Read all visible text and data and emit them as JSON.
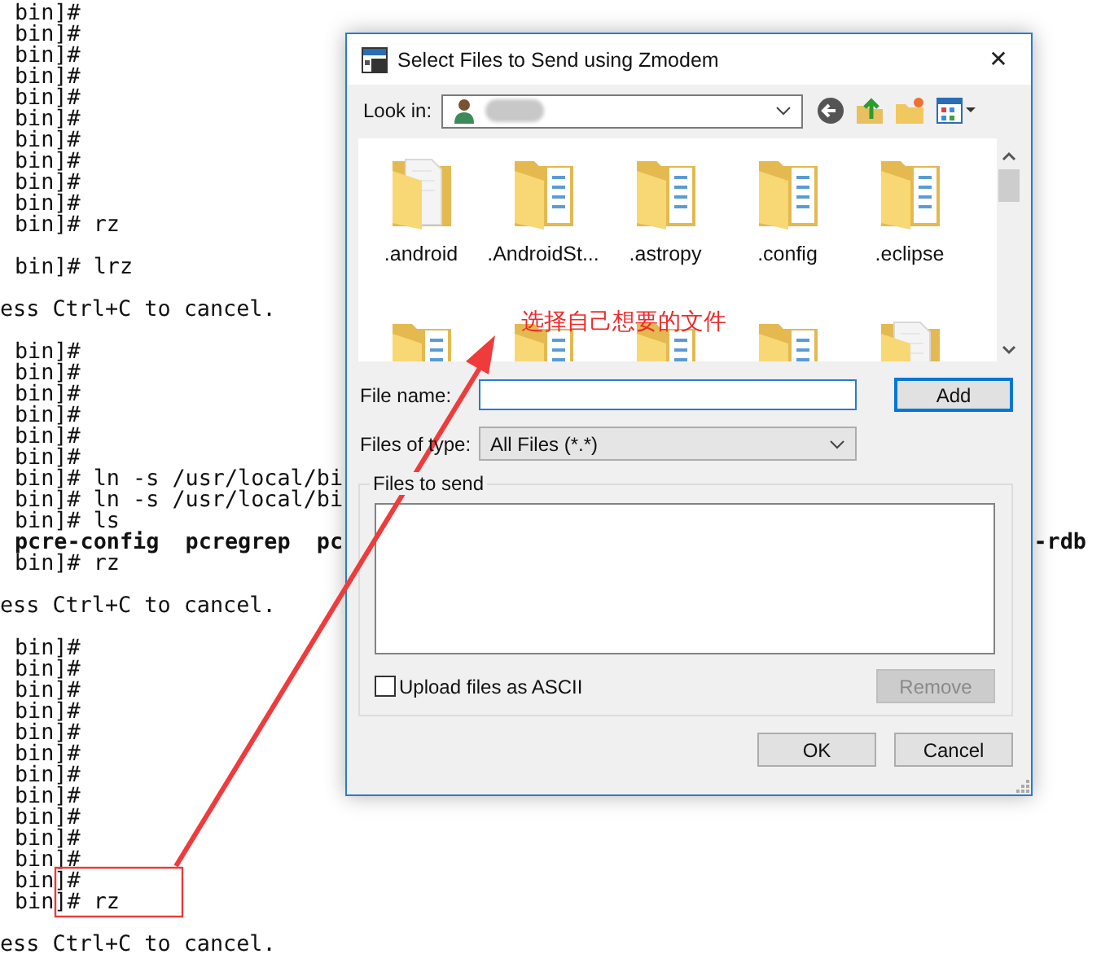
{
  "terminal": {
    "blocks": [
      [
        {
          "kind": "prompt",
          "text": "bin]#"
        },
        {
          "kind": "prompt",
          "text": "bin]#"
        },
        {
          "kind": "prompt",
          "text": "bin]#"
        },
        {
          "kind": "prompt",
          "text": "bin]#"
        },
        {
          "kind": "prompt",
          "text": "bin]#"
        },
        {
          "kind": "prompt",
          "text": "bin]#"
        },
        {
          "kind": "prompt",
          "text": "bin]#"
        },
        {
          "kind": "prompt",
          "text": "bin]#"
        },
        {
          "kind": "prompt",
          "text": "bin]#"
        },
        {
          "kind": "prompt",
          "text": "bin]#"
        },
        {
          "kind": "prompt",
          "text": "bin]# rz"
        }
      ],
      [
        {
          "kind": "prompt",
          "text": "bin]# lrz"
        }
      ],
      [
        {
          "kind": "message",
          "text": "ess Ctrl+C to cancel."
        }
      ],
      [
        {
          "kind": "prompt",
          "text": "bin]#"
        },
        {
          "kind": "prompt",
          "text": "bin]#"
        },
        {
          "kind": "prompt",
          "text": "bin]#"
        },
        {
          "kind": "prompt",
          "text": "bin]#"
        },
        {
          "kind": "prompt",
          "text": "bin]#"
        },
        {
          "kind": "prompt",
          "text": "bin]#"
        },
        {
          "kind": "prompt",
          "text": "bin]# ln -s /usr/local/bi"
        },
        {
          "kind": "prompt",
          "text": "bin]# ln -s /usr/local/bi"
        },
        {
          "kind": "prompt",
          "text": "bin]# ls"
        },
        {
          "kind": "listing",
          "text": "pcre-config  pcregrep  pc",
          "text_right": "-rdb"
        },
        {
          "kind": "prompt",
          "text": "bin]# rz"
        }
      ],
      [
        {
          "kind": "message",
          "text": "ess Ctrl+C to cancel."
        }
      ],
      [
        {
          "kind": "prompt",
          "text": "bin]#"
        },
        {
          "kind": "prompt",
          "text": "bin]#"
        },
        {
          "kind": "prompt",
          "text": "bin]#"
        },
        {
          "kind": "prompt",
          "text": "bin]#"
        },
        {
          "kind": "prompt",
          "text": "bin]#"
        },
        {
          "kind": "prompt",
          "text": "bin]#"
        },
        {
          "kind": "prompt",
          "text": "bin]#"
        },
        {
          "kind": "prompt",
          "text": "bin]#"
        },
        {
          "kind": "prompt",
          "text": "bin]#"
        },
        {
          "kind": "prompt",
          "text": "bin]#"
        },
        {
          "kind": "prompt",
          "text": "bin]#"
        },
        {
          "kind": "prompt",
          "text": "bin]#"
        },
        {
          "kind": "prompt",
          "text": "bin]# rz"
        }
      ],
      [
        {
          "kind": "message",
          "text": "ess Ctrl+C to cancel."
        }
      ]
    ]
  },
  "dialog": {
    "title": "Select Files to Send using Zmodem",
    "close": "✕",
    "look_in": {
      "label": "Look in:"
    },
    "files": [
      {
        "kind": "papers",
        "label": ".android"
      },
      {
        "kind": "plain",
        "label": ".AndroidSt..."
      },
      {
        "kind": "plain",
        "label": ".astropy"
      },
      {
        "kind": "plain",
        "label": ".config"
      },
      {
        "kind": "plain",
        "label": ".eclipse"
      },
      {
        "kind": "plain"
      },
      {
        "kind": "plain"
      },
      {
        "kind": "plain"
      },
      {
        "kind": "plain"
      },
      {
        "kind": "papers"
      }
    ],
    "file_name": {
      "label": "File name:"
    },
    "add_button": {
      "label": "Add",
      "focused": true
    },
    "file_type": {
      "label": "Files of type:",
      "value": "All Files (*.*)"
    },
    "files_to_send": {
      "label": "Files to send"
    },
    "ascii_checkbox": {
      "label": "Upload files as ASCII",
      "checked": false
    },
    "remove_button": {
      "label": "Remove",
      "disabled": true
    },
    "buttons": [
      "OK",
      "Cancel"
    ]
  },
  "annotation": {
    "text": "选择自己想要的文件"
  }
}
